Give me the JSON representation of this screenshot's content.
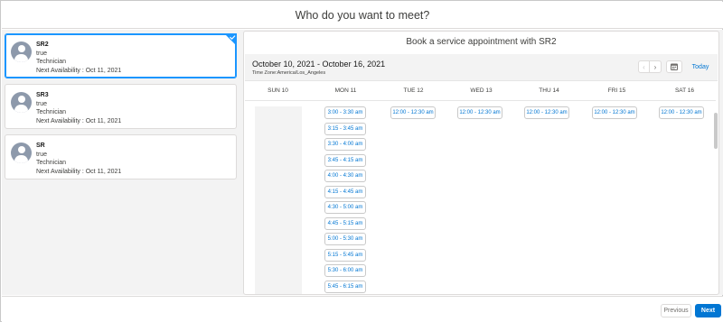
{
  "header": {
    "title": "Who do you want to meet?"
  },
  "resources": [
    {
      "name": "SR2",
      "status": "true",
      "role": "Technician",
      "availability": "Next Availability : Oct 11, 2021",
      "selected": true
    },
    {
      "name": "SR3",
      "status": "true",
      "role": "Technician",
      "availability": "Next Availability : Oct 11, 2021",
      "selected": false
    },
    {
      "name": "SR",
      "status": "true",
      "role": "Technician",
      "availability": "Next Availability : Oct 11, 2021",
      "selected": false
    }
  ],
  "scheduler": {
    "title": "Book a service appointment with SR2",
    "date_range": "October 10, 2021 - October 16, 2021",
    "timezone": "Time Zone:America/Los_Angeles",
    "today_label": "Today",
    "prev_icon": "chevron-left-icon",
    "next_icon": "chevron-right-icon",
    "calendar_icon": "calendar-icon",
    "days": [
      "SUN 10",
      "MON 11",
      "TUE 12",
      "WED 13",
      "THU 14",
      "FRI 15",
      "SAT 16"
    ],
    "slots": {
      "mon": [
        "3:00 - 3:30 am",
        "3:15 - 3:45 am",
        "3:30 - 4:00 am",
        "3:45 - 4:15 am",
        "4:00 - 4:30 am",
        "4:15 - 4:45 am",
        "4:30 - 5:00 am",
        "4:45 - 5:15 am",
        "5:00 - 5:30 am",
        "5:15 - 5:45 am",
        "5:30 - 6:00 am",
        "5:45 - 6:15 am"
      ],
      "tue": [
        "12:00 - 12:30 am"
      ],
      "wed": [
        "12:00 - 12:30 am"
      ],
      "thu": [
        "12:00 - 12:30 am"
      ],
      "fri": [
        "12:00 - 12:30 am"
      ],
      "sat": [
        "12:00 - 12:30 am"
      ]
    }
  },
  "footer": {
    "previous_label": "Previous",
    "next_label": "Next"
  },
  "colors": {
    "accent": "#0176d3",
    "selected_border": "#1b96ff",
    "avatar": "#8d99ab"
  }
}
